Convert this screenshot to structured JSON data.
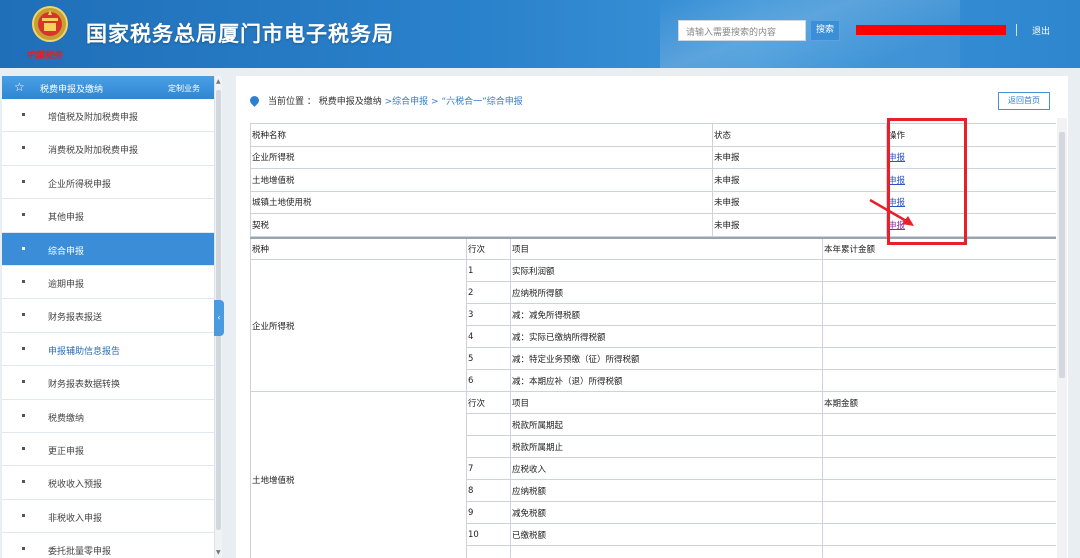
{
  "header": {
    "title": "国家税务总局厦门市电子税务局",
    "logo_text": "中国税务",
    "search_placeholder": "请输入需要搜索的内容",
    "search_button": "搜索",
    "logout": "退出",
    "colors": {
      "header_bg": "#2b82cc",
      "redaction": "#ff0000"
    }
  },
  "sidebar": {
    "heading": "税费申报及缴纳",
    "custom": "定制业务",
    "items": [
      {
        "label": "增值税及附加税费申报"
      },
      {
        "label": "消费税及附加税费申报"
      },
      {
        "label": "企业所得税申报"
      },
      {
        "label": "其他申报"
      },
      {
        "label": "综合申报"
      },
      {
        "label": "逾期申报"
      },
      {
        "label": "财务报表报送"
      },
      {
        "label": "申报辅助信息报告"
      },
      {
        "label": "财务报表数据转换"
      },
      {
        "label": "税费缴纳"
      },
      {
        "label": "更正申报"
      },
      {
        "label": "税收收入预报"
      },
      {
        "label": "非税收入申报"
      },
      {
        "label": "委托批量零申报"
      }
    ]
  },
  "main": {
    "crumb_prefix": "当前位置 ：",
    "crumb_1": "税费申报及缴纳",
    "crumb_2": " >综合申报 > ",
    "crumb_3": "“六税合一”综合申报",
    "home_button": "返回首页",
    "status_table": {
      "headers": {
        "name": "税种名称",
        "status": "状态",
        "op": "操作"
      },
      "rows": [
        {
          "name": "企业所得税",
          "status": "未申报",
          "op": "申报"
        },
        {
          "name": "土地增值税",
          "status": "未申报",
          "op": "申报"
        },
        {
          "name": "城镇土地使用税",
          "status": "未申报",
          "op": "申报"
        },
        {
          "name": "契税",
          "status": "未申报",
          "op": "申报"
        }
      ]
    },
    "detail_table": {
      "headers": {
        "tax": "税种",
        "seq": "行次",
        "item": "项目",
        "amount": "本年累计金额"
      },
      "cit": {
        "name": "企业所得税",
        "rows": [
          {
            "seq": "1",
            "item": "实际利润额"
          },
          {
            "seq": "2",
            "item": "应纳税所得额"
          },
          {
            "seq": "3",
            "item": "减：减免所得税额"
          },
          {
            "seq": "4",
            "item": "减：实际已缴纳所得税额"
          },
          {
            "seq": "5",
            "item": "减：特定业务预缴（征）所得税额"
          },
          {
            "seq": "6",
            "item": "减：本期应补（退）所得税额"
          }
        ]
      },
      "lvat": {
        "name": "土地增值税",
        "sub_headers": {
          "seq": "行次",
          "item": "项目",
          "amount": "本期金额"
        },
        "rows": [
          {
            "seq": "",
            "item": "税款所属期起"
          },
          {
            "seq": "",
            "item": "税款所属期止"
          },
          {
            "seq": "7",
            "item": "应税收入"
          },
          {
            "seq": "8",
            "item": "应纳税额"
          },
          {
            "seq": "9",
            "item": "减免税额"
          },
          {
            "seq": "10",
            "item": "已缴税额"
          },
          {
            "seq": "",
            "item": ""
          }
        ]
      }
    }
  }
}
